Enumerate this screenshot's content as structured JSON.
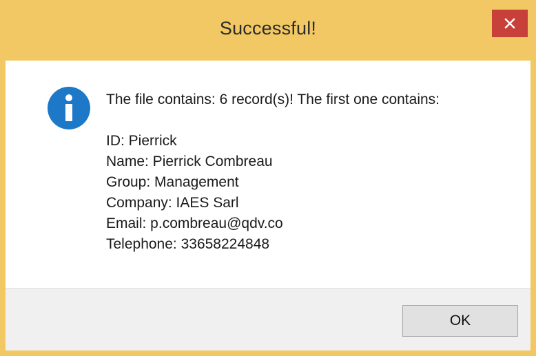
{
  "dialog": {
    "title": "Successful!",
    "close_icon": "close-icon",
    "message_icon": "info-icon",
    "colors": {
      "titlebar": "#f1c863",
      "close_button": "#c7403a",
      "info_icon": "#1e78c8"
    }
  },
  "message": {
    "summary": "The file contains: 6 record(s)! The first one contains:",
    "lines": [
      "ID: Pierrick",
      "Name: Pierrick Combreau",
      "Group: Management",
      "Company: IAES Sarl",
      "Email: p.combreau@qdv.co",
      "Telephone: 33658224848"
    ]
  },
  "buttons": {
    "ok_label": "OK"
  }
}
